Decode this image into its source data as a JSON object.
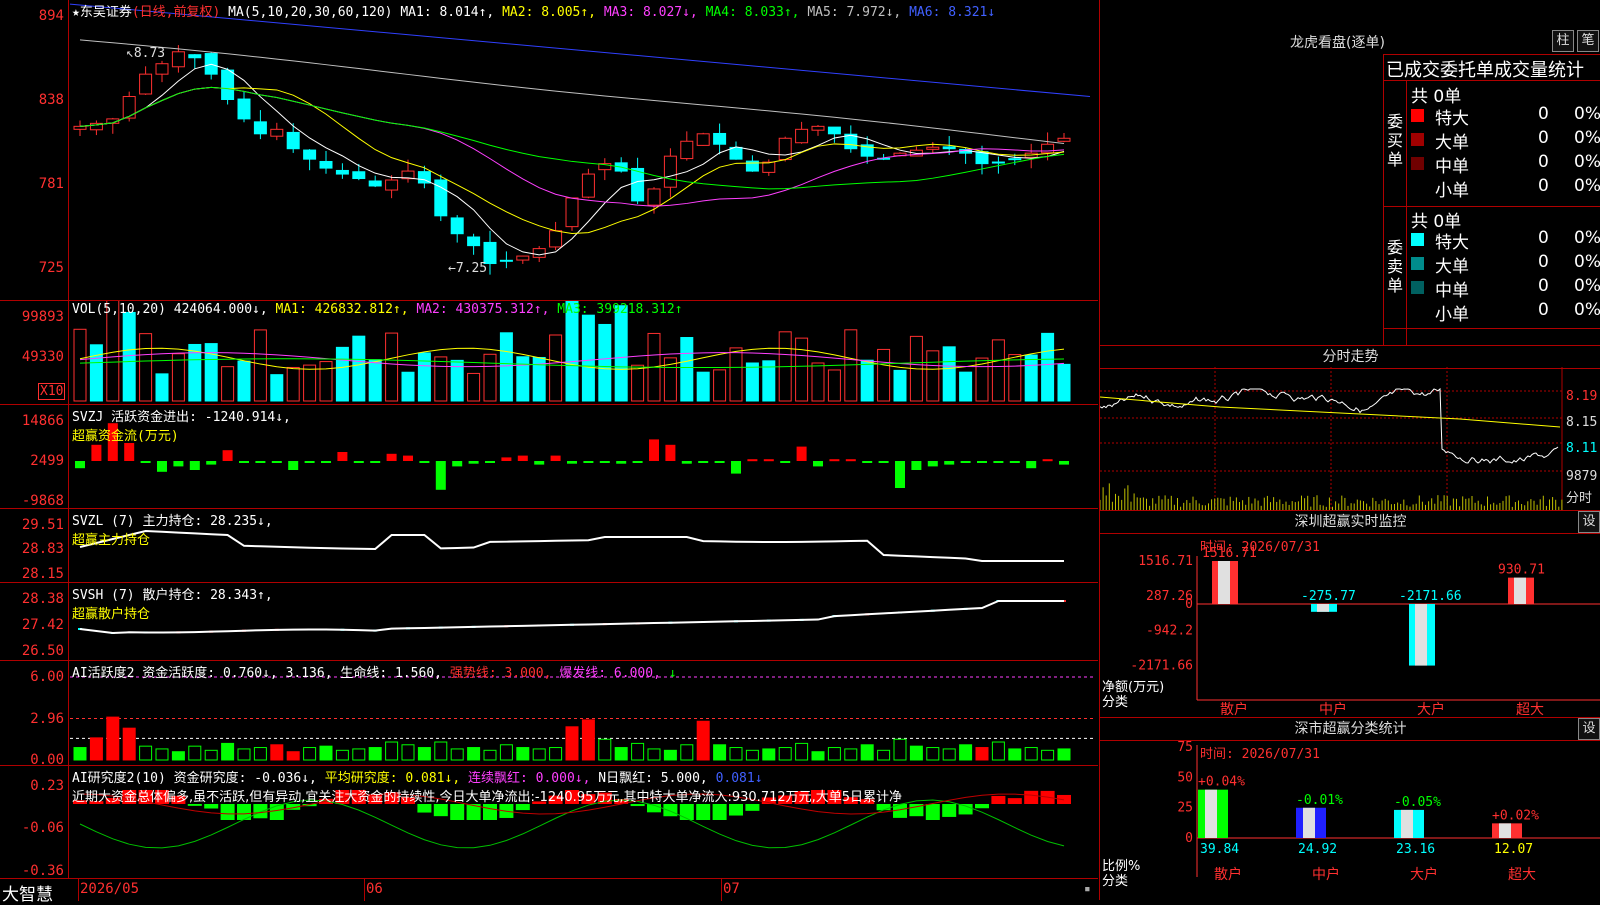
{
  "main_title": {
    "stock": "★东吴证券",
    "mode": "(日线,前复权)",
    "ma_head": "MA(5,10,20,30,60,120)",
    "ma1": "MA1: 8.014↑,",
    "ma2": "MA2: 8.005↑,",
    "ma3": "MA3: 8.027↓,",
    "ma4": "MA4: 8.033↑,",
    "ma5": "MA5: 7.972↓,",
    "ma6": "MA6: 8.321↓"
  },
  "price_axis": [
    "894",
    "838",
    "781",
    "725"
  ],
  "annotations": {
    "high": "8.73",
    "low": "7.25"
  },
  "vol_title": {
    "head": "VOL(5,10,20)",
    "v": "424064.000↓,",
    "ma1": "MA1: 426832.812↑,",
    "ma2": "MA2: 430375.312↑,",
    "ma3": "MA3: 399218.312↑"
  },
  "vol_axis": [
    "99893",
    "49330"
  ],
  "vol_unit": "X10",
  "svzj_title": {
    "head": "SVZJ  活跃资金进出: -1240.914↓,",
    "sub": "超赢资金流(万元)"
  },
  "svzj_axis": [
    "14866",
    "2499",
    "-9868"
  ],
  "svzl_title": {
    "head": "SVZL (7) 主力持仓: 28.235↓,",
    "sub": "超赢主力持仓"
  },
  "svzl_axis": [
    "29.51",
    "28.83",
    "28.15"
  ],
  "svsh_title": {
    "head": "SVSH (7) 散户持仓: 28.343↑,",
    "sub": "超赢散户持仓"
  },
  "svsh_axis": [
    "28.38",
    "27.42",
    "26.50"
  ],
  "ai1_title": {
    "a": "AI活跃度2 资金活跃度: 0.760↓,",
    "b": "3.136,",
    "c": "生命线: 1.560,",
    "d": "强势线: 3.000,",
    "e": "爆发线: 6.000,",
    "f": "↓"
  },
  "ai1_axis": [
    "6.00",
    "2.96",
    "0.00"
  ],
  "ai2_title": {
    "a": "AI研究度2(10) 资金研究度: -0.036↓,",
    "b": "平均研究度: 0.081↓,",
    "c": "连续飘红: 0.000↓,",
    "d": "N日飘红: 5.000,",
    "e": "0.081↓"
  },
  "ai2_text": "近期大资金总体偏多,虽不活跃,但有异动,宜关注大资金的持续性,今日大单净流出:-1240.95万元,其中特大单净流入:930.712万元,大单5日累计净",
  "ai2_axis": [
    "0.23",
    "-0.06",
    "-0.36"
  ],
  "bottom_bar": {
    "brand": "大智慧",
    "d1": "2026/05",
    "d2": "06",
    "d3": "07"
  },
  "longhu": {
    "title": "龙虎看盘(逐单)",
    "btn1": "柱",
    "btn2": "笔",
    "header": "已成交委托单成交量统计",
    "buy_label": "委买单",
    "sell_label": "委卖单",
    "buy_total": "共 0单",
    "sell_total": "共 0单",
    "buy_rows": [
      {
        "name": "特大",
        "val": "0",
        "pct": "0%",
        "color": "#ff0000"
      },
      {
        "name": "大单",
        "val": "0",
        "pct": "0%",
        "color": "#a00000"
      },
      {
        "name": "中单",
        "val": "0",
        "pct": "0%",
        "color": "#700000"
      },
      {
        "name": "小单",
        "val": "0",
        "pct": "0%",
        "color": "#000000"
      }
    ],
    "sell_rows": [
      {
        "name": "特大",
        "val": "0",
        "pct": "0%",
        "color": "#00ffff"
      },
      {
        "name": "大单",
        "val": "0",
        "pct": "0%",
        "color": "#008c8c"
      },
      {
        "name": "中单",
        "val": "0",
        "pct": "0%",
        "color": "#006060"
      },
      {
        "name": "小单",
        "val": "0",
        "pct": "0%",
        "color": "#000000"
      }
    ]
  },
  "fenshi": {
    "title": "分时走势",
    "p1": "8.19",
    "p2": "8.15",
    "p3": "8.11",
    "vol": "9879",
    "unit": "分时"
  },
  "sz_monitor": {
    "title": "深圳超赢实时监控",
    "btn": "设",
    "time": "时间: 2026/07/31",
    "axis": [
      "1516.71",
      "287.26",
      "0",
      "-942.2",
      "-2171.66"
    ],
    "ylabel1": "净额(万元)",
    "ylabel2": "分类",
    "cats": [
      "散户",
      "中户",
      "大户",
      "超大"
    ],
    "vals": [
      "1516.71",
      "-275.77",
      "-2171.66",
      "930.71"
    ]
  },
  "sz_class": {
    "title": "深市超赢分类统计",
    "btn": "设",
    "time": "时间: 2026/07/31",
    "axis": [
      "75",
      "50",
      "25",
      "0"
    ],
    "ylabel1": "比例%",
    "ylabel2": "分类",
    "cats": [
      "散户",
      "中户",
      "大户",
      "超大"
    ],
    "top": [
      "+0.04%",
      "-0.01%",
      "-0.05%",
      "+0.02%"
    ],
    "vals": [
      "39.84",
      "24.92",
      "23.16",
      "12.07"
    ]
  }
}
